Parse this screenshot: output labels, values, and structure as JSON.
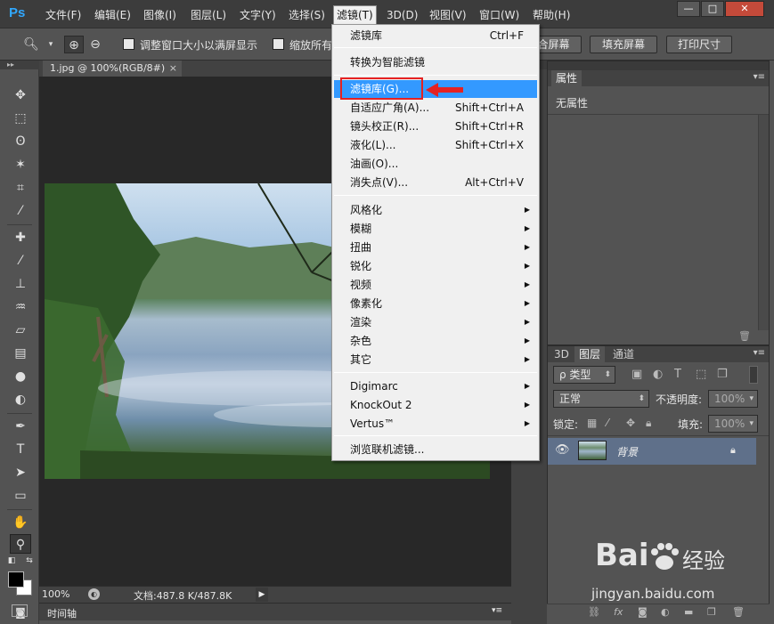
{
  "app": {
    "logo": "Ps"
  },
  "menubar": {
    "items": [
      "文件(F)",
      "编辑(E)",
      "图像(I)",
      "图层(L)",
      "文字(Y)",
      "选择(S)",
      "滤镜(T)",
      "3D(D)",
      "视图(V)",
      "窗口(W)",
      "帮助(H)"
    ],
    "active_index": 6
  },
  "window_controls": {
    "minimize": "—",
    "maximize": "□",
    "close": "✕"
  },
  "options_bar": {
    "resize_window_label": "调整窗口大小以满屏显示",
    "zoom_all_label": "缩放所有",
    "fit_screen_label": "合屏幕",
    "fill_screen_label": "填充屏幕",
    "print_size_label": "打印尺寸"
  },
  "document": {
    "tab_title": "1.jpg @ 100%(RGB/8#)",
    "tab_close": "×",
    "zoom": "100%",
    "doc_size": "文档:487.8 K/487.8K"
  },
  "timeline": {
    "label": "时间轴"
  },
  "properties_panel": {
    "tab": "属性",
    "content": "无属性"
  },
  "layers_panel": {
    "tabs": [
      "3D",
      "图层",
      "通道"
    ],
    "active_tab": 1,
    "filter_type": "ρ 类型",
    "blend_mode": "正常",
    "opacity_label": "不透明度:",
    "opacity_value": "100%",
    "lock_label": "锁定:",
    "fill_label": "填充:",
    "fill_value": "100%",
    "layers": [
      {
        "name": "背景",
        "visible": true,
        "locked": true
      }
    ]
  },
  "filter_menu": {
    "items": [
      {
        "label": "滤镜库",
        "shortcut": "Ctrl+F"
      },
      {
        "label": "转换为智能滤镜"
      },
      {
        "label": "滤镜库(G)...",
        "highlighted": true
      },
      {
        "label": "自适应广角(A)...",
        "shortcut": "Shift+Ctrl+A"
      },
      {
        "label": "镜头校正(R)...",
        "shortcut": "Shift+Ctrl+R"
      },
      {
        "label": "液化(L)...",
        "shortcut": "Shift+Ctrl+X"
      },
      {
        "label": "油画(O)..."
      },
      {
        "label": "消失点(V)...",
        "shortcut": "Alt+Ctrl+V"
      },
      {
        "label": "风格化",
        "submenu": true
      },
      {
        "label": "模糊",
        "submenu": true
      },
      {
        "label": "扭曲",
        "submenu": true
      },
      {
        "label": "锐化",
        "submenu": true
      },
      {
        "label": "视频",
        "submenu": true
      },
      {
        "label": "像素化",
        "submenu": true
      },
      {
        "label": "渲染",
        "submenu": true
      },
      {
        "label": "杂色",
        "submenu": true
      },
      {
        "label": "其它",
        "submenu": true
      },
      {
        "label": "Digimarc",
        "submenu": true
      },
      {
        "label": "KnockOut 2",
        "submenu": true
      },
      {
        "label": "Vertus™",
        "submenu": true
      },
      {
        "label": "浏览联机滤镜..."
      }
    ]
  },
  "annotation": {
    "color": "#e52222"
  },
  "watermark": {
    "brand": "Bai",
    "brand_suffix": "经验",
    "url": "jingyan.baidu.com"
  },
  "colors": {
    "accent": "#31a8ff",
    "menu_highlight": "#3399ff",
    "layer_selected": "#5f708a"
  }
}
